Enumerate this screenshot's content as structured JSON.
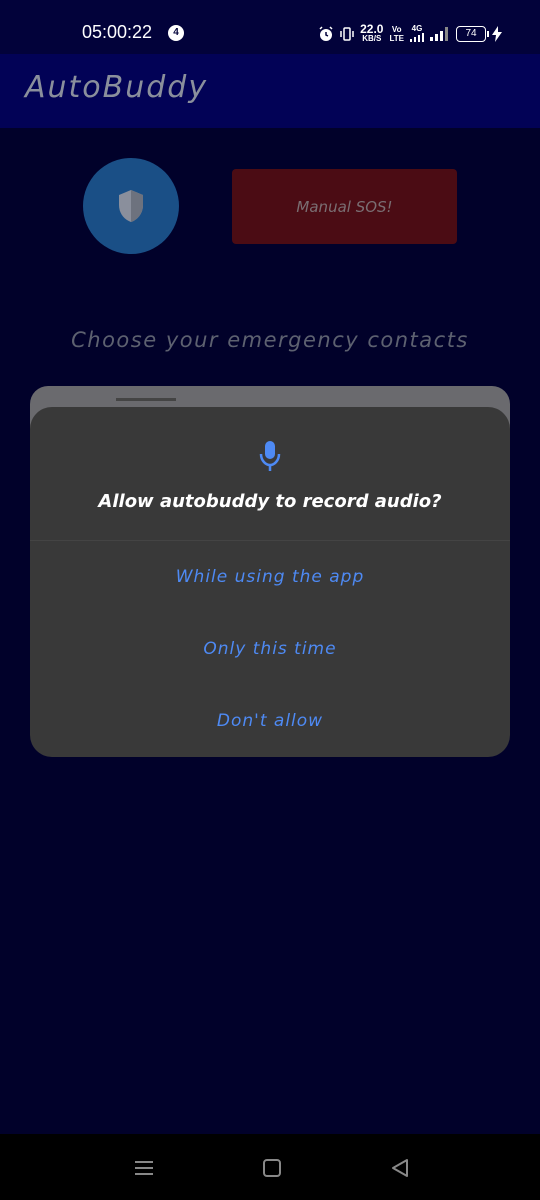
{
  "status_bar": {
    "time": "05:00:22",
    "notification_count": "4",
    "network_speed_value": "22.0",
    "network_speed_unit": "KB/S",
    "volte_top": "Vo",
    "volte_bottom": "LTE",
    "network_type": "4G",
    "battery_level": "74"
  },
  "app_bar": {
    "title": "AutoBuddy"
  },
  "main": {
    "sos_button_label": "Manual SOS!",
    "contacts_heading": "Choose your emergency contacts"
  },
  "permission_dialog": {
    "icon": "microphone-icon",
    "title": "Allow autobuddy to record audio?",
    "options": [
      "While using the app",
      "Only this time",
      "Don't allow"
    ]
  },
  "colors": {
    "background": "#01012a",
    "app_bar": "#020256",
    "shield_circle": "#1a4f86",
    "sos_button": "#4b0c14",
    "dialog_background": "#393939",
    "accent_blue": "#4e8af4"
  }
}
